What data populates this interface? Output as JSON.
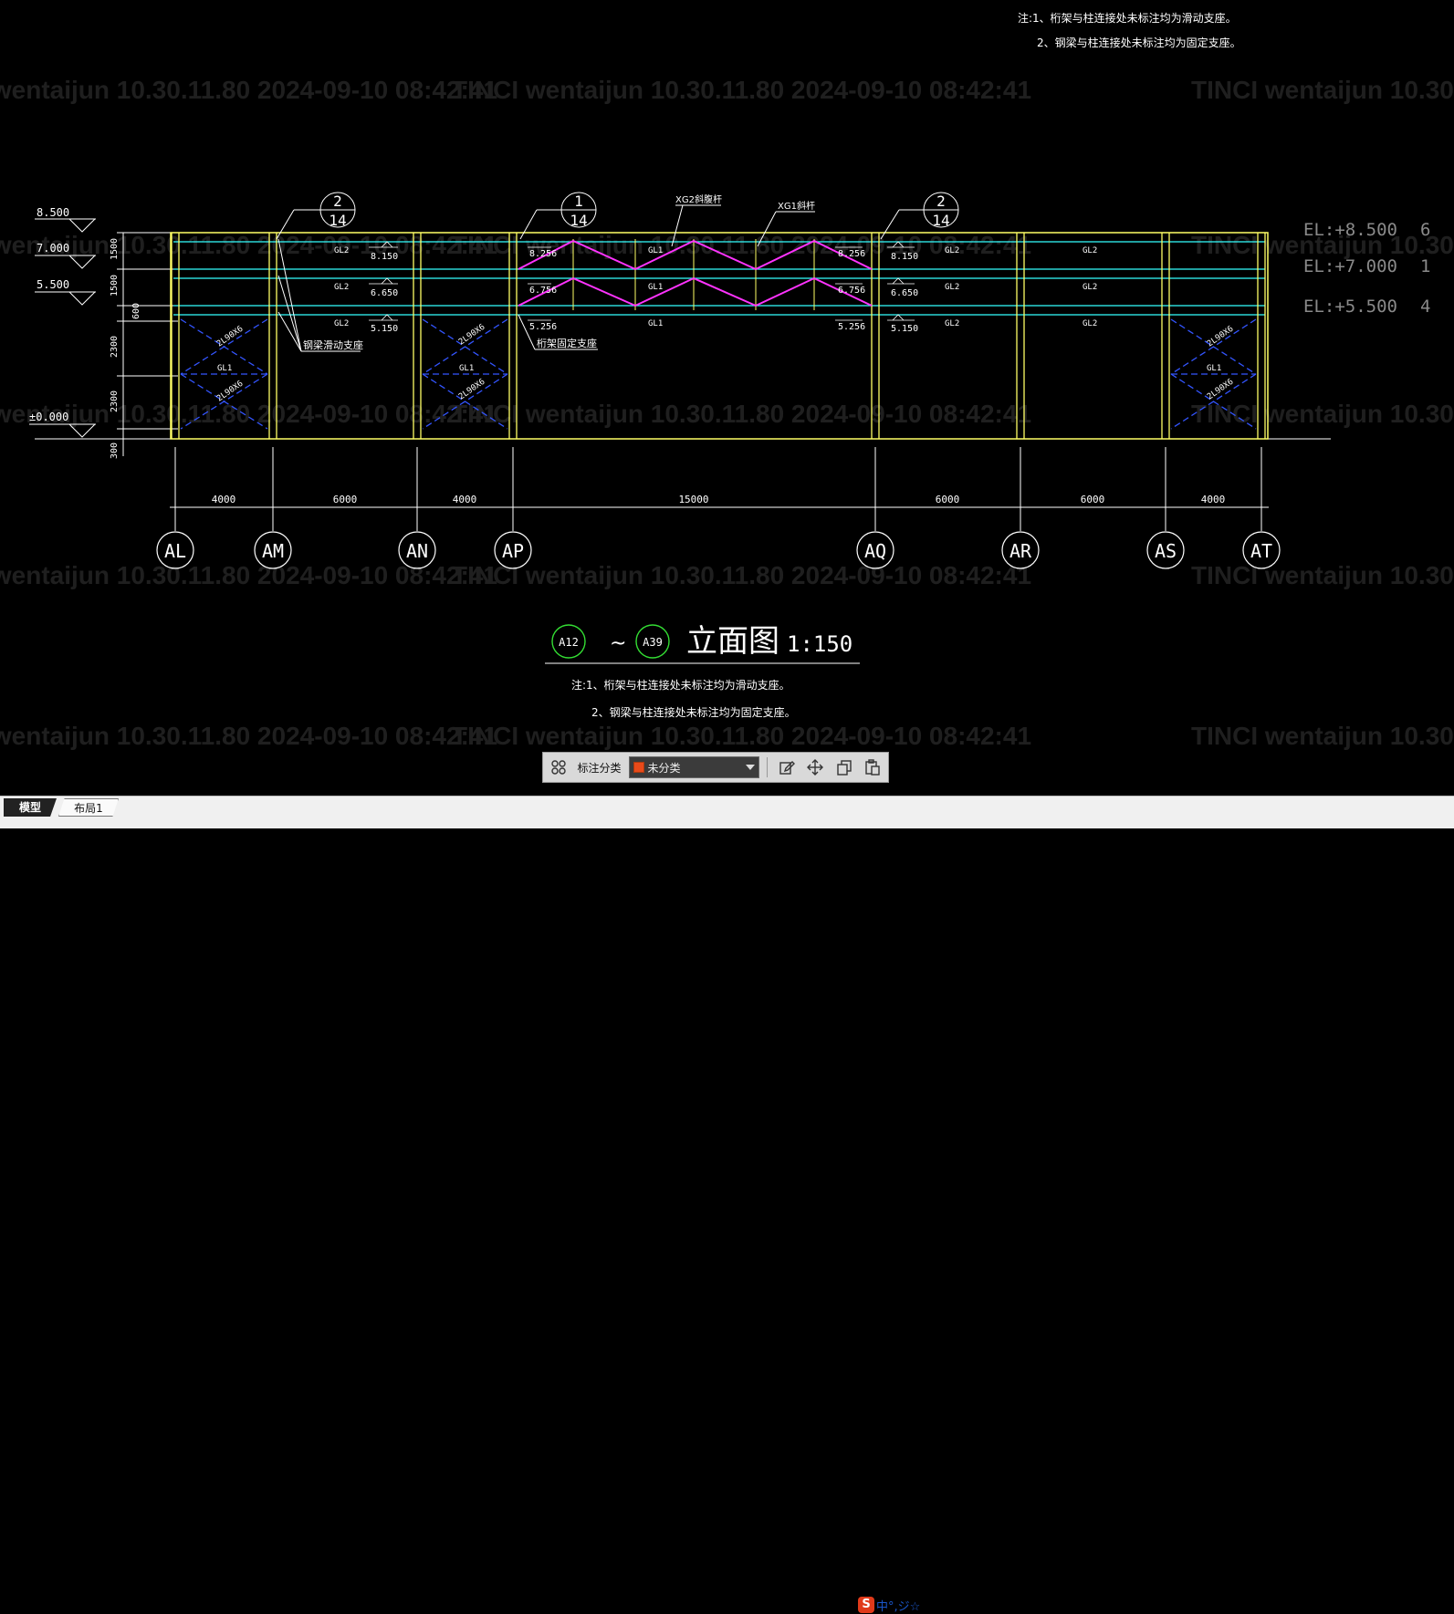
{
  "drawing": {
    "watermark_text": "TINCI  wentaijun  10.30.11.80  2024-09-10  08:42:41",
    "notes_top": [
      "注:1、桁架与柱连接处未标注均为滑动支座。",
      "2、钢梁与柱连接处未标注均为固定支座。"
    ],
    "notes_bottom": [
      "注:1、桁架与柱连接处未标注均为滑动支座。",
      "2、钢梁与柱连接处未标注均为固定支座。"
    ],
    "levels_left": [
      "8.500",
      "7.000",
      "5.500",
      "±0.000"
    ],
    "level_dims_vertical": [
      "1500",
      "1500",
      "600",
      "2300",
      "2300",
      "300"
    ],
    "el_labels_right": [
      "EL:+8.500",
      "EL:+7.000",
      "EL:+5.500"
    ],
    "el_suffix_right": [
      "6",
      "1",
      "4"
    ],
    "detail_callouts": [
      {
        "top": "2",
        "bottom": "14"
      },
      {
        "top": "1",
        "bottom": "14"
      },
      {
        "top": "2",
        "bottom": "14"
      }
    ],
    "member_labels": {
      "xg2": "XG2斜腹杆",
      "xg1": "XG1斜杆",
      "gl1": "GL1",
      "gl2": "GL2",
      "brace": "2L90X6",
      "slide_support": "钢梁滑动支座",
      "fixed_support": "桁架固定支座"
    },
    "elev_marks": {
      "am": [
        "8.150",
        "6.650",
        "5.150"
      ],
      "ap": [
        "8.256",
        "6.756",
        "5.256"
      ],
      "aq_left": [
        "8.256",
        "6.756",
        "5.256"
      ],
      "aq_right": [
        "8.150",
        "6.650",
        "5.150"
      ]
    },
    "spans": [
      "4000",
      "6000",
      "4000",
      "15000",
      "6000",
      "6000",
      "4000"
    ],
    "axes": [
      "AL",
      "AM",
      "AN",
      "AP",
      "AQ",
      "AR",
      "AS",
      "AT"
    ],
    "title": {
      "from_axis": "A12",
      "to_axis": "A39",
      "tilde": "~",
      "name": "立面图",
      "scale": "1:150"
    }
  },
  "toolbar": {
    "grid_icon": "grid-icon",
    "label": "标注分类",
    "select_value": "未分类",
    "select_color": "#e84a1a",
    "actions": [
      "edit-icon",
      "move-icon",
      "copy-icon",
      "paste-icon"
    ]
  },
  "tabs": {
    "model": "模型",
    "layout": "布局1"
  },
  "ime": {
    "logo": "S",
    "text": "中°,ジ☆"
  },
  "colors": {
    "background": "#000000",
    "column": "#ffff66",
    "beam": "#33ffff",
    "truss_diag": "#ff33ff",
    "brace": "#3355ff",
    "line": "#ffffff"
  }
}
